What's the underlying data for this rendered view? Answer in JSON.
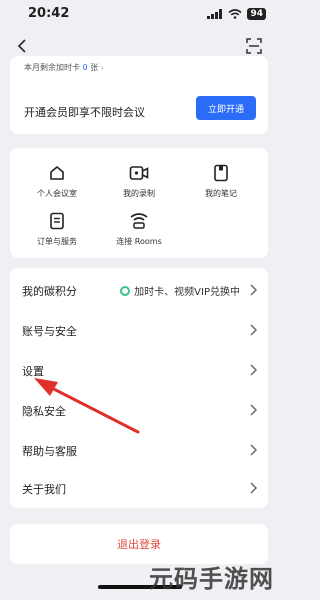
{
  "status_bar": {
    "time": "20:42",
    "battery": "94"
  },
  "member_card": {
    "remaining_prefix": "本月剩余加时卡",
    "remaining_count": "0",
    "remaining_suffix": "张",
    "promo_text": "开通会员即享不限时会议",
    "open_button": "立即开通"
  },
  "grid": {
    "items": [
      {
        "label": "个人会议室",
        "icon": "home-icon"
      },
      {
        "label": "我的录制",
        "icon": "video-icon"
      },
      {
        "label": "我的笔记",
        "icon": "note-icon"
      },
      {
        "label": "订单与服务",
        "icon": "order-icon"
      },
      {
        "label": "连接 Rooms",
        "icon": "wifi-icon"
      }
    ]
  },
  "list": {
    "items": [
      {
        "label": "我的碳积分",
        "extra": "加时卡、视频VIP兑换中"
      },
      {
        "label": "账号与安全"
      },
      {
        "label": "设置"
      },
      {
        "label": "隐私安全"
      },
      {
        "label": "帮助与客服"
      },
      {
        "label": "关于我们"
      }
    ]
  },
  "logout_label": "退出登录",
  "watermark": "元码手游网",
  "colors": {
    "accent": "#2a6cf5",
    "logout": "#e04a3a",
    "arrow": "#e0302a",
    "carbon": "#3cc38a"
  }
}
